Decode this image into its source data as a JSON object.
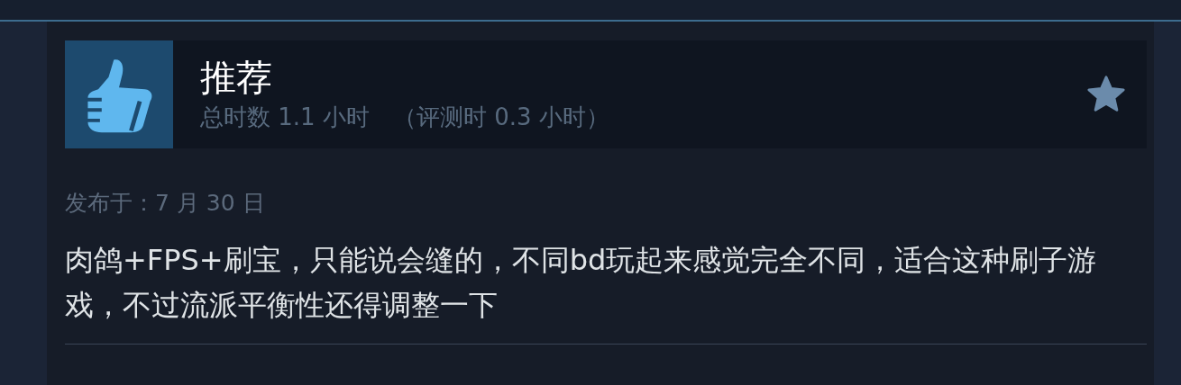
{
  "review": {
    "kind": "recommended",
    "verdict": "推荐",
    "hours": "总时数 1.1 小时",
    "review_hours": "（评测时 0.3 小时）",
    "posted": "发布于：7 月 30 日",
    "text": "肉鸽+FPS+刷宝，只能说会缝的，不同bd玩起来感觉完全不同，适合这种刷子游戏，不过流派平衡性还得调整一下"
  }
}
